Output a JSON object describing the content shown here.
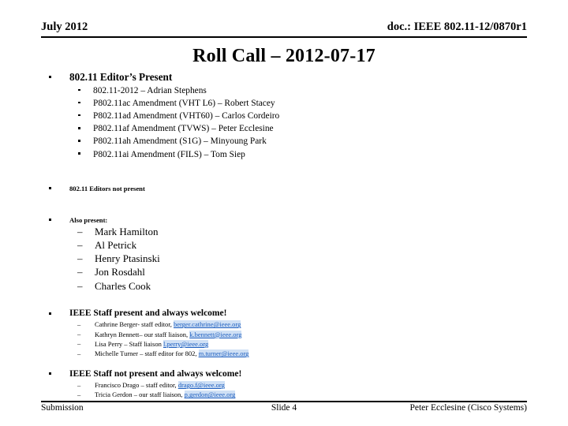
{
  "header": {
    "left": "July 2012",
    "right": "doc.: IEEE 802.11-12/0870r1"
  },
  "title": "Roll Call – 2012-07-17",
  "sections": {
    "editors_present": {
      "heading": "802.11 Editor’s Present",
      "items": [
        "802.11-2012 – Adrian Stephens",
        "P802.11ac Amendment (VHT L6) – Robert Stacey",
        "P802.11ad Amendment (VHT60) – Carlos Cordeiro",
        "P802.11af Amendment (TVWS) – Peter Ecclesine",
        "P802.11ah Amendment (S1G) – Minyoung Park",
        "P802.11ai Amendment (FILS) – Tom Siep"
      ]
    },
    "editors_not_present": {
      "heading": "802.11 Editors not present"
    },
    "also_present": {
      "heading": "Also present:",
      "items": [
        "Mark Hamilton",
        "Al Petrick",
        "Henry Ptasinski",
        "Jon Rosdahl",
        "Charles Cook"
      ]
    },
    "staff_present": {
      "heading": "IEEE Staff present and always welcome!",
      "items": [
        {
          "text": "Cathrine Berger- staff editor, ",
          "email": "berger.cathrine@ieee.org"
        },
        {
          "text": "Kathryn Bennett– our staff liaison, ",
          "email": "k.bennett@ieee.org"
        },
        {
          "text": "Lisa Perry – Staff liaison ",
          "email": "l.perry@ieee.org"
        },
        {
          "text": "Michelle Turner – staff editor for 802, ",
          "email": "m.turner@ieee.org"
        }
      ]
    },
    "staff_not_present": {
      "heading": "IEEE Staff not present and always welcome!",
      "items": [
        {
          "text": "Francisco Drago – staff editor, ",
          "email": "drago.f@ieee.org"
        },
        {
          "text": "Tricia Gerdon – our staff liaison, ",
          "email": "p.gerdon@ieee.org"
        }
      ]
    }
  },
  "footer": {
    "left": "Submission",
    "center": "Slide 4",
    "right": "Peter Ecclesine (Cisco Systems)"
  },
  "colors": {
    "link": "#1F5FBF",
    "link_highlight": "#CFE0F5",
    "text": "#000000"
  }
}
